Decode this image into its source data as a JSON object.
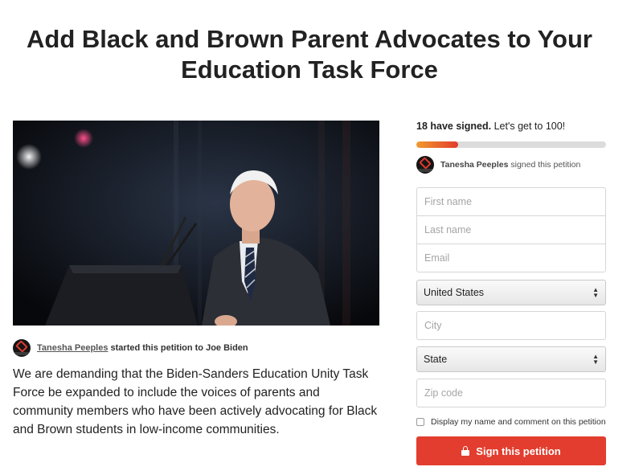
{
  "petition": {
    "title": "Add Black and Brown Parent Advocates to Your Education Task Force",
    "starter_name": "Tanesha Peeples",
    "starter_text": "started this petition to Joe Biden",
    "description": "We are demanding that the Biden-Sanders Education Unity Task Force be expanded to include the voices of parents and community members who have been actively advocating for Black and Brown students in low-income communities."
  },
  "sidebar": {
    "signed_count": "18 have signed.",
    "signed_goal": "Let's get to 100!",
    "progress_fraction": 0.22,
    "recent_signer": "Tanesha Peeples",
    "recent_text": "signed this petition"
  },
  "form": {
    "first_name_placeholder": "First name",
    "last_name_placeholder": "Last name",
    "email_placeholder": "Email",
    "country_value": "United States",
    "city_placeholder": "City",
    "state_value": "State",
    "zip_placeholder": "Zip code",
    "display_checkbox_label": "Display my name and comment on this petition",
    "display_checked": false,
    "sign_button_label": "Sign this petition"
  },
  "colors": {
    "accent": "#e23d2e",
    "progress_start": "#f2992e",
    "progress_track": "#dcdcdc"
  },
  "icons": {
    "lock": "lock-icon",
    "select_arrows": "select-arrows-icon",
    "avatar": "avatar-logo"
  }
}
